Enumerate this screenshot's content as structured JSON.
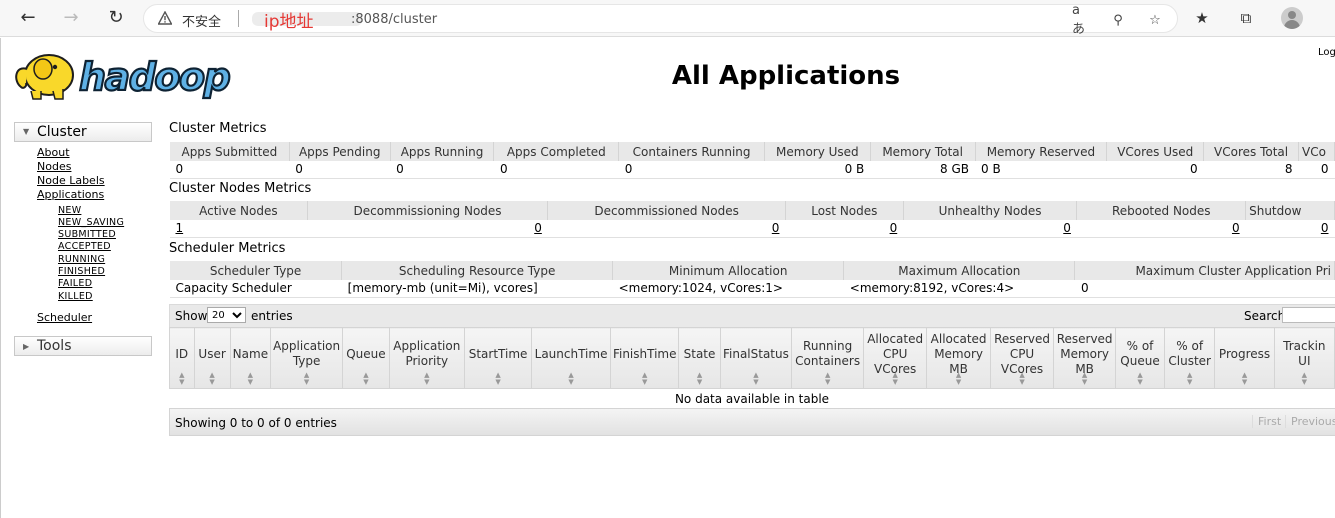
{
  "browser": {
    "security_label": "不安全",
    "address_mask": "ip地址",
    "address_rest": ":8088/cluster"
  },
  "page": {
    "login": "Log",
    "title": "All Applications",
    "logo_text": "hadoop"
  },
  "sidebar": {
    "cluster_label": "Cluster",
    "links": [
      "About",
      "Nodes",
      "Node Labels",
      "Applications"
    ],
    "app_states": [
      "NEW",
      "NEW_SAVING",
      "SUBMITTED",
      "ACCEPTED",
      "RUNNING",
      "FINISHED",
      "FAILED",
      "KILLED"
    ],
    "scheduler": "Scheduler",
    "tools_label": "Tools"
  },
  "cluster_metrics": {
    "title": "Cluster Metrics",
    "headers": [
      "Apps Submitted",
      "Apps Pending",
      "Apps Running",
      "Apps Completed",
      "Containers Running",
      "Memory Used",
      "Memory Total",
      "Memory Reserved",
      "VCores Used",
      "VCores Total",
      "VCo"
    ],
    "values": [
      "0",
      "0",
      "0",
      "0",
      "0",
      "0 B",
      "8 GB",
      "0 B",
      "0",
      "8",
      "0"
    ]
  },
  "node_metrics": {
    "title": "Cluster Nodes Metrics",
    "headers": [
      "Active Nodes",
      "Decommissioning Nodes",
      "Decommissioned Nodes",
      "Lost Nodes",
      "Unhealthy Nodes",
      "Rebooted Nodes",
      "Shutdow"
    ],
    "values": [
      "1",
      "0",
      "0",
      "0",
      "0",
      "0",
      "0"
    ]
  },
  "scheduler_metrics": {
    "title": "Scheduler Metrics",
    "headers": [
      "Scheduler Type",
      "Scheduling Resource Type",
      "Minimum Allocation",
      "Maximum Allocation",
      "Maximum Cluster Application Pri"
    ],
    "values": [
      "Capacity Scheduler",
      "[memory-mb (unit=Mi), vcores]",
      "<memory:1024, vCores:1>",
      "<memory:8192, vCores:4>",
      "0"
    ]
  },
  "apps_table": {
    "show_label": "Show",
    "page_size": "20",
    "entries_label": "entries",
    "search_label": "Search:",
    "columns": [
      [
        "ID"
      ],
      [
        "User"
      ],
      [
        "Name"
      ],
      [
        "Application",
        "Type"
      ],
      [
        "Queue"
      ],
      [
        "Application",
        "Priority"
      ],
      [
        "StartTime"
      ],
      [
        "LaunchTime"
      ],
      [
        "FinishTime"
      ],
      [
        "State"
      ],
      [
        "FinalStatus"
      ],
      [
        "Running",
        "Containers"
      ],
      [
        "Allocated",
        "CPU",
        "VCores"
      ],
      [
        "Allocated",
        "Memory",
        "MB"
      ],
      [
        "Reserved",
        "CPU",
        "VCores"
      ],
      [
        "Reserved",
        "Memory",
        "MB"
      ],
      [
        "% of",
        "Queue"
      ],
      [
        "% of",
        "Cluster"
      ],
      [
        "Progress"
      ],
      [
        "Trackin",
        "UI"
      ]
    ],
    "empty_message": "No data available in table",
    "info": "Showing 0 to 0 of 0 entries",
    "first": "First",
    "previous": "Previous"
  }
}
